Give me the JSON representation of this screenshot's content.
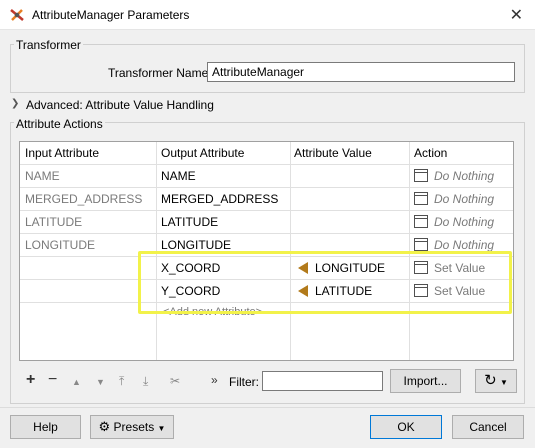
{
  "window": {
    "title": "AttributeManager Parameters"
  },
  "transformer": {
    "group_label": "Transformer",
    "name_label": "Transformer Name:",
    "name_value": "AttributeManager"
  },
  "advanced": {
    "label": "Advanced: Attribute Value Handling"
  },
  "actions": {
    "group_label": "Attribute Actions",
    "columns": [
      "Input Attribute",
      "Output Attribute",
      "Attribute Value",
      "Action"
    ],
    "rows": [
      {
        "input": "NAME",
        "output": "NAME",
        "value": "",
        "action": "Do Nothing"
      },
      {
        "input": "MERGED_ADDRESS",
        "output": "MERGED_ADDRESS",
        "value": "",
        "action": "Do Nothing"
      },
      {
        "input": "LATITUDE",
        "output": "LATITUDE",
        "value": "",
        "action": "Do Nothing"
      },
      {
        "input": "LONGITUDE",
        "output": "LONGITUDE",
        "value": "",
        "action": "Do Nothing"
      },
      {
        "input": "",
        "output": "X_COORD",
        "value": "LONGITUDE",
        "action": "Set Value"
      },
      {
        "input": "",
        "output": "Y_COORD",
        "value": "LATITUDE",
        "action": "Set Value"
      }
    ],
    "add_new": "<Add new Attribute>"
  },
  "toolbar": {
    "add": "+",
    "remove": "−",
    "up": "▲",
    "down": "▼",
    "top": "⤒",
    "bottom": "⤓",
    "cut": "✂",
    "more": "»",
    "filter_label": "Filter:",
    "filter_value": "",
    "import_label": "Import...",
    "refresh_label": "↻"
  },
  "footer": {
    "help": "Help",
    "presets": "Presets",
    "ok": "OK",
    "cancel": "Cancel"
  },
  "colors": {
    "highlight": "#f2f24a",
    "arrow": "#b27a1a",
    "ok_border": "#0078d7"
  }
}
